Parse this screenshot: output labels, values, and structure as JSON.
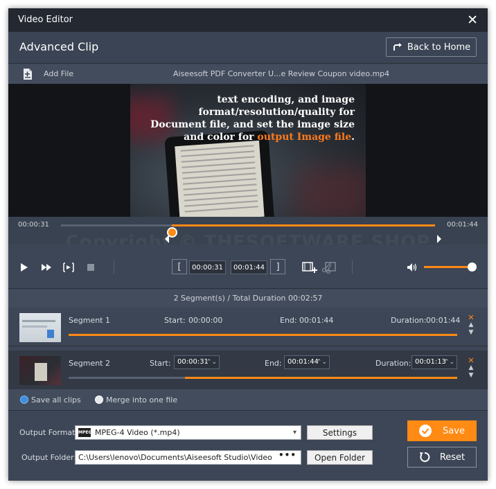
{
  "window": {
    "title": "Video Editor"
  },
  "header": {
    "page_title": "Advanced Clip",
    "back_label": "Back to Home"
  },
  "file": {
    "add_label": "Add File",
    "filename": "Aiseesoft PDF Converter U...e Review Coupon video.mp4"
  },
  "preview": {
    "overlay_lines": [
      "text encoding, and image",
      "format/resolution/quality for",
      "Document file, and set the image size"
    ],
    "overlay_last_prefix": "and color for ",
    "overlay_highlight": "output Image file",
    "overlay_suffix": ".",
    "highlight_color": "#ff7a1a"
  },
  "watermark": "Copyright © THESOFTWARE.SHOP",
  "timeline": {
    "start_time": "00:00:31",
    "end_time": "00:01:44",
    "progress": 0.296
  },
  "controls": {
    "start_value": "00:00:31",
    "end_value": "00:01:44",
    "volume": 1.0
  },
  "summary": "2 Segment(s) / Total Duration 00:02:57",
  "segments": [
    {
      "name": "Segment 1",
      "start_label": "Start:",
      "start": "00:00:00",
      "end_label": "End:",
      "end": "00:01:44",
      "duration_label": "Duration:",
      "duration": "00:01:44",
      "selected_fraction": 1.0
    },
    {
      "name": "Segment 2",
      "start_label": "Start:",
      "start": "00:00:31",
      "end_label": "End:",
      "end": "00:01:44",
      "duration_label": "Duration:",
      "duration": "00:01:13",
      "selected_fraction": 0.7
    }
  ],
  "merge": {
    "save_all_label": "Save all clips",
    "merge_label": "Merge into one file",
    "selected": "save_all"
  },
  "output": {
    "format_label": "Output Format:",
    "format_value": "MPEG-4 Video (*.mp4)",
    "format_badge": "MPEG4",
    "settings_label": "Settings",
    "folder_label": "Output Folder:",
    "folder_value": "C:\\Users\\lenovo\\Documents\\Aiseesoft Studio\\Video",
    "folder_dots": "•••",
    "open_folder_label": "Open Folder",
    "save_label": "Save",
    "reset_label": "Reset"
  },
  "colors": {
    "accent": "#ff8a14",
    "background": "#3d4656",
    "titlebar": "#232831"
  }
}
